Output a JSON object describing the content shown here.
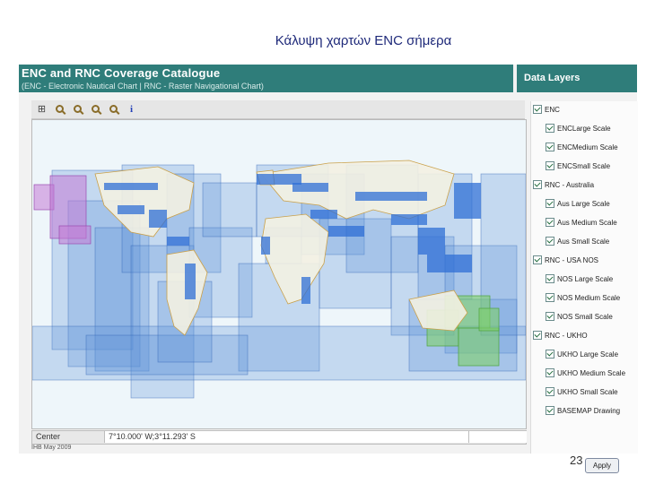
{
  "slide": {
    "title": "Κάλυψη χαρτών ENC σήμερα",
    "page_number": "23"
  },
  "app": {
    "title": "ENC and RNC Coverage Catalogue",
    "subtitle": "(ENC - Electronic Nautical Chart | RNC - Raster Navigational Chart)",
    "footer": "IHB May 2009",
    "toolbar": [
      {
        "name": "full-extent-icon",
        "glyph": "⊞"
      },
      {
        "name": "zoom-in-icon",
        "glyph": "+"
      },
      {
        "name": "zoom-out-icon",
        "glyph": "−"
      },
      {
        "name": "zoom-icon",
        "glyph": ""
      },
      {
        "name": "zoom-previous-icon",
        "glyph": ""
      },
      {
        "name": "info-icon",
        "glyph": "i"
      }
    ],
    "status": {
      "label": "Center",
      "coordinates": "7°10.000' W;3°11.293' S"
    }
  },
  "layers": {
    "header": "Data Layers",
    "apply_label": "Apply",
    "items": [
      {
        "label": "ENC",
        "level": 0,
        "checked": true
      },
      {
        "label": "ENCLarge Scale",
        "level": 1,
        "checked": true
      },
      {
        "label": "ENCMedium Scale",
        "level": 1,
        "checked": true
      },
      {
        "label": "ENCSmall Scale",
        "level": 1,
        "checked": true
      },
      {
        "label": "RNC - Australia",
        "level": 0,
        "checked": true
      },
      {
        "label": "Aus Large Scale",
        "level": 1,
        "checked": true
      },
      {
        "label": "Aus Medium Scale",
        "level": 1,
        "checked": true
      },
      {
        "label": "Aus Small Scale",
        "level": 1,
        "checked": true
      },
      {
        "label": "RNC - USA NOS",
        "level": 0,
        "checked": true
      },
      {
        "label": "NOS Large Scale",
        "level": 1,
        "checked": true
      },
      {
        "label": "NOS Medium Scale",
        "level": 1,
        "checked": true
      },
      {
        "label": "NOS Small Scale",
        "level": 1,
        "checked": true
      },
      {
        "label": "RNC - UKHO",
        "level": 0,
        "checked": true
      },
      {
        "label": "UKHO Large Scale",
        "level": 1,
        "checked": true
      },
      {
        "label": "UKHO Medium Scale",
        "level": 1,
        "checked": true
      },
      {
        "label": "UKHO Small Scale",
        "level": 1,
        "checked": true
      },
      {
        "label": "BASEMAP Drawing",
        "level": 1,
        "checked": true
      }
    ]
  },
  "colors": {
    "header_bg": "#2f7d7a",
    "ocean": "#e8f4f8",
    "coverage_blue": "#5b8fd6",
    "coverage_purple": "#c57ad6",
    "coverage_green": "#7fd16a",
    "land": "#f1efe0"
  }
}
